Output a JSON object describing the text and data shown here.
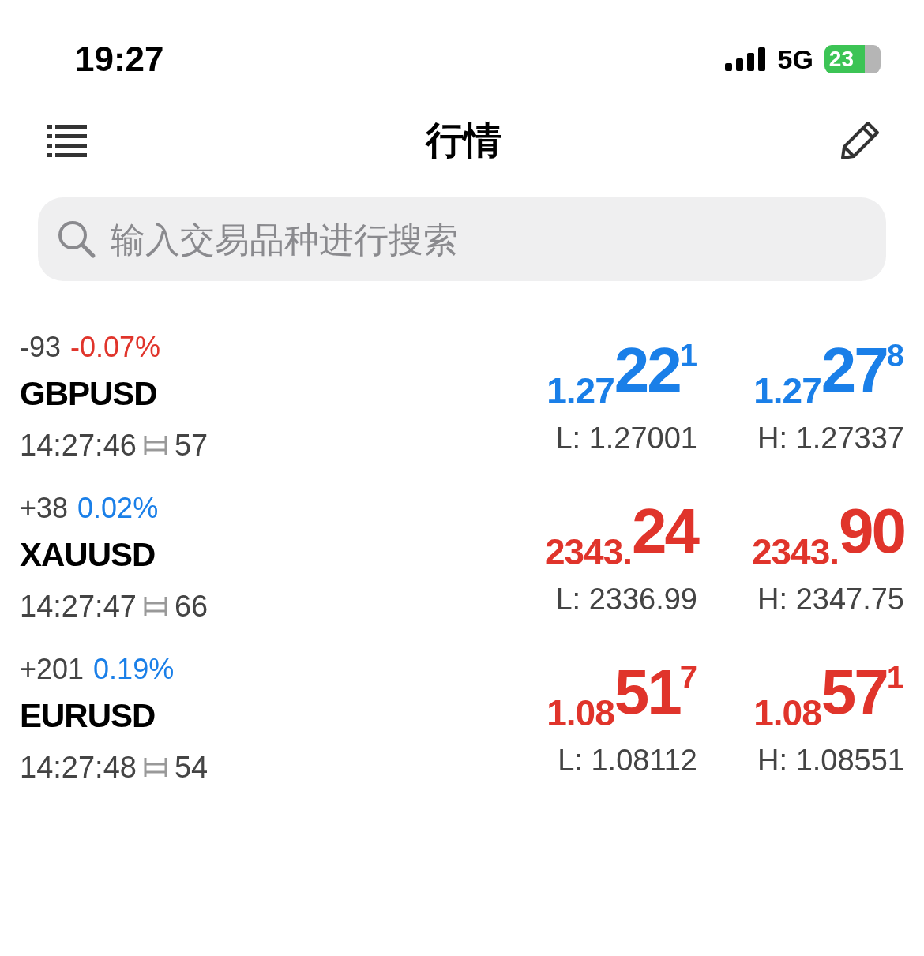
{
  "status_bar": {
    "time": "19:27",
    "network": "5G",
    "battery": "23"
  },
  "header": {
    "title": "行情"
  },
  "search": {
    "placeholder": "输入交易品种进行搜索"
  },
  "rows": [
    {
      "change": "-93",
      "percent": "-0.07%",
      "color": "#e0342b",
      "symbol": "GBPUSD",
      "time": "14:27:46",
      "spread": "57",
      "bid": {
        "prefix": "1.27",
        "big": "22",
        "sup": "1",
        "color": "#1a7fe8"
      },
      "ask": {
        "prefix": "1.27",
        "big": "27",
        "sup": "8",
        "color": "#1a7fe8"
      },
      "low": "L: 1.27001",
      "high": "H: 1.27337"
    },
    {
      "change": "+38",
      "percent": "0.02%",
      "color": "#1a7fe8",
      "symbol": "XAUUSD",
      "time": "14:27:47",
      "spread": "66",
      "bid": {
        "prefix": "2343.",
        "big": "24",
        "color": "#e0342b"
      },
      "ask": {
        "prefix": "2343.",
        "big": "90",
        "color": "#e0342b"
      },
      "low": "L: 2336.99",
      "high": "H: 2347.75"
    },
    {
      "change": "+201",
      "percent": "0.19%",
      "color": "#1a7fe8",
      "symbol": "EURUSD",
      "time": "14:27:48",
      "spread": "54",
      "bid": {
        "prefix": "1.08",
        "big": "51",
        "sup": "7",
        "color": "#e0342b"
      },
      "ask": {
        "prefix": "1.08",
        "big": "57",
        "sup": "1",
        "color": "#e0342b"
      },
      "low": "L: 1.08112",
      "high": "H: 1.08551"
    }
  ]
}
